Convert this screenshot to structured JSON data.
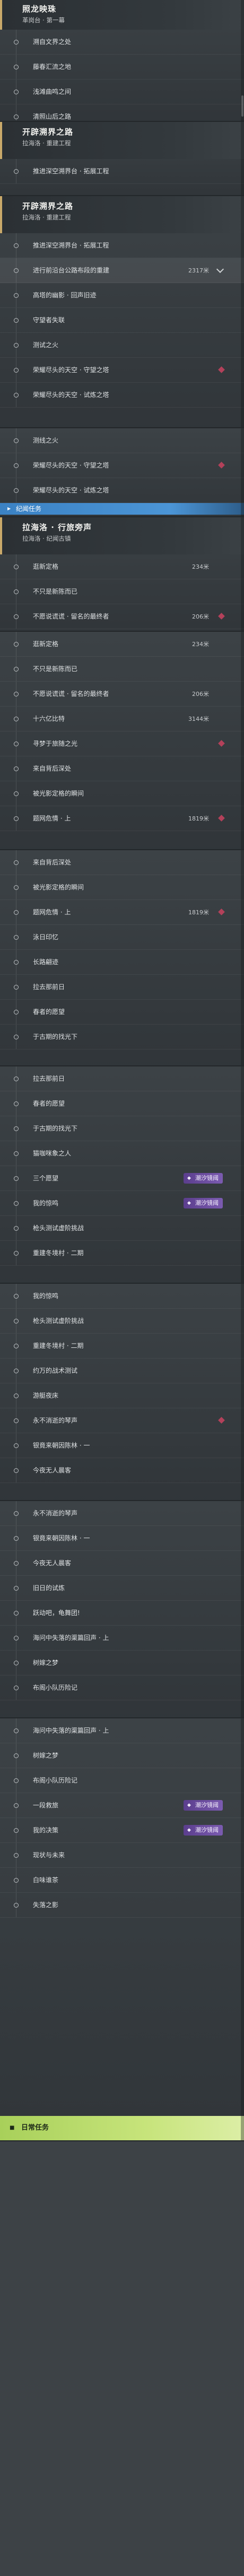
{
  "p1": {
    "title": "照龙映珠",
    "sub": "革岗台 · 第一幕",
    "rows": [
      "溯自文界之处",
      "藤春汇流之地",
      "浅滩曲鸣之间",
      "清照山后之路"
    ]
  },
  "p2": {
    "title": "开辟溯界之路",
    "sub": "拉海洛 · 重建工程",
    "rows": [
      "推进深空溯界台 · 拓展工程"
    ]
  },
  "p3": {
    "title": "开辟溯界之路",
    "sub": "拉海洛 · 重建工程",
    "rows": [
      {
        "label": "推进深空溯界台 · 拓展工程",
        "count": ""
      },
      {
        "label": "进行前沿台公路布段的重建",
        "count": "2317米"
      },
      {
        "label": "高塔的幽影 · 回声旧迹",
        "count": ""
      },
      {
        "label": "守望者失联",
        "count": ""
      },
      {
        "label": "测试之火",
        "count": ""
      },
      {
        "label": "荣耀尽头的天空 · 守望之塔",
        "count": ""
      },
      {
        "label": "荣耀尽头的天空 · 试炼之塔",
        "count": ""
      }
    ]
  },
  "p4": {
    "rows": [
      "测线之火",
      "荣耀尽头的天空 · 守望之塔",
      "荣耀尽头的天空 · 试炼之塔"
    ],
    "bar": "纪闻任务"
  },
  "p5": {
    "title": "拉海洛 · 行旅旁声",
    "sub": "拉海洛 · 纪闻古镇",
    "rows": [
      {
        "label": "逛新定格",
        "count": "234米"
      },
      {
        "label": "不只是新陈而已",
        "count": ""
      },
      {
        "label": "不愿说谎谎 · 留名的最终者",
        "count": "206米"
      }
    ]
  },
  "p6": {
    "rows": [
      {
        "label": "逛新定格",
        "count": "234米"
      },
      {
        "label": "不只是新陈而已",
        "count": ""
      },
      {
        "label": "不愿说谎谎 · 留名的最终者",
        "count": "206米"
      },
      {
        "label": "十六亿比特",
        "count": "3144米"
      },
      {
        "label": "寻梦于旅随之光",
        "count": ""
      },
      {
        "label": "来自背后深处",
        "count": ""
      },
      {
        "label": "被光影定格的瞬间",
        "count": ""
      },
      {
        "label": "题网危情 · 上",
        "count": "1819米"
      }
    ]
  },
  "p7": {
    "rows": [
      {
        "label": "来自背后深处",
        "count": ""
      },
      {
        "label": "被光影定格的瞬间",
        "count": ""
      },
      {
        "label": "题网危情 · 上",
        "count": "1819米"
      },
      {
        "label": "泳日印忆",
        "count": ""
      },
      {
        "label": "长路翩迹",
        "count": ""
      },
      {
        "label": "拉去那前日",
        "count": ""
      },
      {
        "label": "春者的愿望",
        "count": ""
      },
      {
        "label": "于古期的找光下",
        "count": ""
      }
    ]
  },
  "p8": {
    "badge": "潮汐镜阈",
    "rows": [
      "拉去那前日",
      "春者的愿望",
      "于古期的找光下",
      "猫咖咪象之人",
      "三个愿望",
      "我的惊鸣",
      "枪头测试虚阶挑战",
      "重建冬境村 · 二期"
    ]
  },
  "p9": {
    "rows": [
      "我的惊鸣",
      "枪头测试虚阶挑战",
      "重建冬境村 · 二期",
      "约万的战术测试",
      "游艇夜床",
      "永不消逝的琴声",
      "银竟来朝因陈林 · 一",
      "今夜无人晨客"
    ]
  },
  "p10": {
    "rows": [
      "永不消逝的琴声",
      "银竟来朝因陈林 · 一",
      "今夜无人晨客",
      "旧日的试炼",
      "跃动吧，龟舞团!",
      "海问中失落的渠篇回声 · 上",
      "树嫁之梦",
      "布阁小队历险记"
    ]
  },
  "p11": {
    "badge": "潮汐镜阈",
    "rows": [
      "海问中失落的渠篇回声 · 上",
      "树嫁之梦",
      "布阁小队历险记",
      "一段救旅",
      "我的决策",
      "现状与未来",
      "白味谁茶",
      "失落之影"
    ],
    "footer": "日常任务"
  }
}
